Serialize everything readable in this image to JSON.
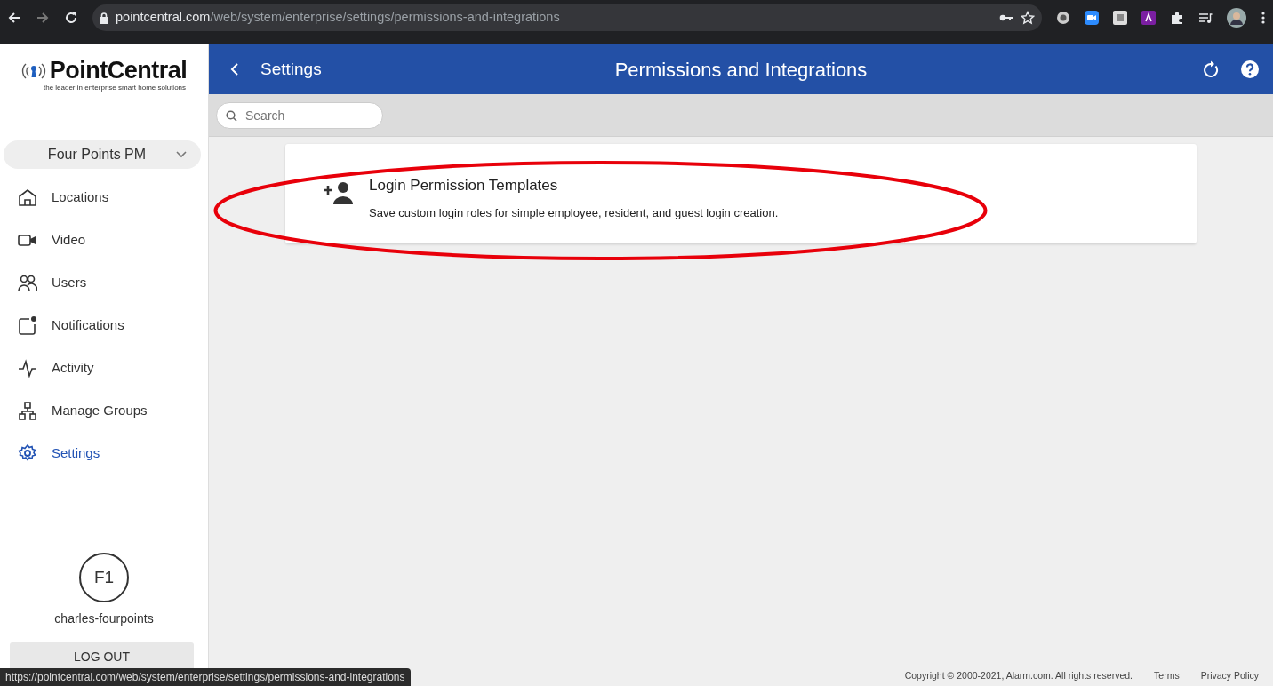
{
  "browser": {
    "url_host": "pointcentral.com",
    "url_path": "/web/system/enterprise/settings/permissions-and-integrations",
    "status_url": "https://pointcentral.com/web/system/enterprise/settings/permissions-and-integrations"
  },
  "sidebar": {
    "logo": {
      "name": "PointCentral",
      "tagline": "the leader in enterprise smart home solutions"
    },
    "org_selector": "Four Points PM",
    "items": [
      {
        "label": "Locations",
        "selected": false
      },
      {
        "label": "Video",
        "selected": false
      },
      {
        "label": "Users",
        "selected": false
      },
      {
        "label": "Notifications",
        "selected": false
      },
      {
        "label": "Activity",
        "selected": false
      },
      {
        "label": "Manage Groups",
        "selected": false
      },
      {
        "label": "Settings",
        "selected": true
      }
    ],
    "user": {
      "initials": "F1",
      "username": "charles-fourpoints"
    },
    "logout": "LOG OUT"
  },
  "header": {
    "back_label": "Settings",
    "title": "Permissions and Integrations"
  },
  "search": {
    "placeholder": "Search"
  },
  "cards": [
    {
      "title": "Login Permission Templates",
      "description": "Save custom login roles for simple employee, resident, and guest login creation.",
      "highlighted": true
    }
  ],
  "footer": {
    "copyright": "Copyright © 2000-2021, Alarm.com. All rights reserved.",
    "links": [
      "Terms",
      "Privacy Policy"
    ]
  }
}
